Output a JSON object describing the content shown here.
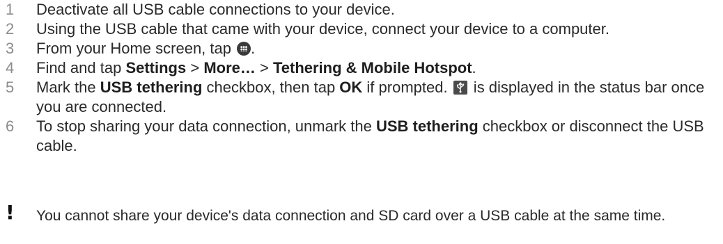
{
  "steps": [
    {
      "num": "1",
      "text": "Deactivate all USB cable connections to your device."
    },
    {
      "num": "2",
      "text": "Using the USB cable that came with your device, connect your device to a computer."
    },
    {
      "num": "3",
      "prefix": "From your Home screen, tap ",
      "icon": "apps-icon",
      "suffix": "."
    },
    {
      "num": "4",
      "prefix": "Find and tap ",
      "b1": "Settings",
      "sep1": " > ",
      "b2": "More…",
      "sep2": " > ",
      "b3": "Tethering & Mobile Hotspot",
      "suffix": "."
    },
    {
      "num": "5",
      "prefix": "Mark the ",
      "b1": "USB tethering",
      "mid1": " checkbox, then tap ",
      "b2": "OK",
      "mid2": " if prompted. ",
      "icon": "usb-tethering-status-icon",
      "suffix": " is displayed in the status bar once you are connected."
    },
    {
      "num": "6",
      "prefix": "To stop sharing your data connection, unmark the ",
      "b1": "USB tethering",
      "suffix": " checkbox or disconnect the USB cable."
    }
  ],
  "note": {
    "icon": "warning-exclamation-icon",
    "symbol": "!",
    "text": "You cannot share your device's data connection and SD card over a USB cable at the same time."
  }
}
